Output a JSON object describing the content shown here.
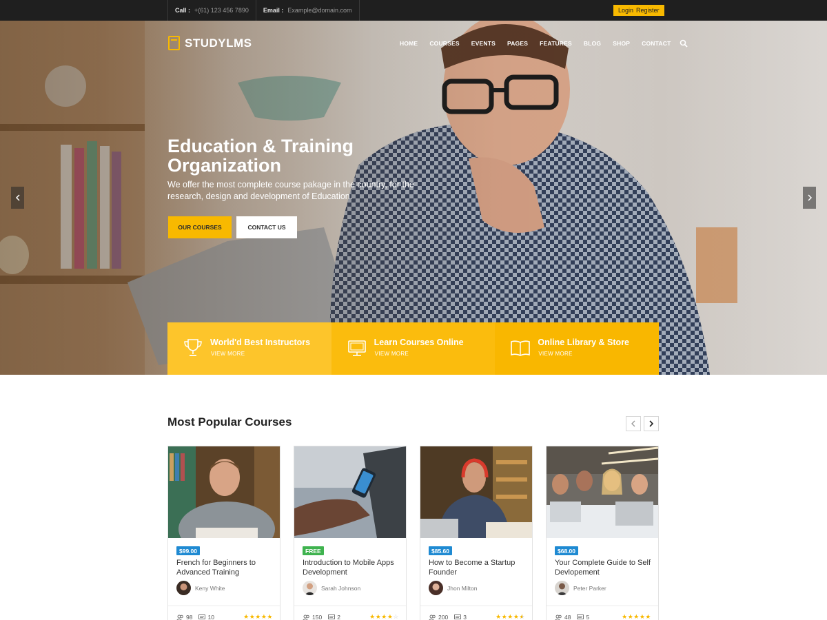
{
  "topbar": {
    "call_label": "Call :",
    "call_value": "+(61) 123 456 7890",
    "email_label": "Email :",
    "email_value": "Example@domain.com",
    "login": "Login",
    "register": "Register"
  },
  "brand": {
    "name": "STUDYLMS",
    "accent": "#f8b900"
  },
  "nav": [
    "HOME",
    "COURSES",
    "EVENTS",
    "PAGES",
    "FEATURES",
    "BLOG",
    "SHOP",
    "CONTACT"
  ],
  "hero": {
    "title": "Education & Training Organization",
    "subtitle": "We offer the most complete course pakage in the country, for the research, design and development of Education.",
    "primary_button": "OUR COURSES",
    "secondary_button": "CONTACT US"
  },
  "features": [
    {
      "title": "World'd Best Instructors",
      "link": "VIEW MORE",
      "icon": "trophy-icon",
      "bg": "#fdc52b"
    },
    {
      "title": "Learn Courses Online",
      "link": "VIEW MORE",
      "icon": "monitor-icon",
      "bg": "#fbbc0d"
    },
    {
      "title": "Online Library & Store",
      "link": "VIEW MORE",
      "icon": "book-icon",
      "bg": "#f9b700"
    }
  ],
  "courses_section": {
    "title": "Most Popular Courses",
    "courses": [
      {
        "price": "$99.00",
        "price_color": "#1f8ad2",
        "title": "French for Beginners to Advanced Training",
        "author": "Keny White",
        "students": "98",
        "comments": "10",
        "rating": 5
      },
      {
        "price": "FREE",
        "price_color": "#3fb34f",
        "title": "Introduction to Mobile Apps Development",
        "author": "Sarah Johnson",
        "students": "150",
        "comments": "2",
        "rating": 4
      },
      {
        "price": "$85.60",
        "price_color": "#1f8ad2",
        "title": "How to Become a Startup Founder",
        "author": "Jhon Milton",
        "students": "200",
        "comments": "3",
        "rating": 4.5
      },
      {
        "price": "$68.00",
        "price_color": "#1f8ad2",
        "title": "Your Complete Guide to Self Devlopement",
        "author": "Peter Parker",
        "students": "48",
        "comments": "5",
        "rating": 5
      }
    ]
  }
}
